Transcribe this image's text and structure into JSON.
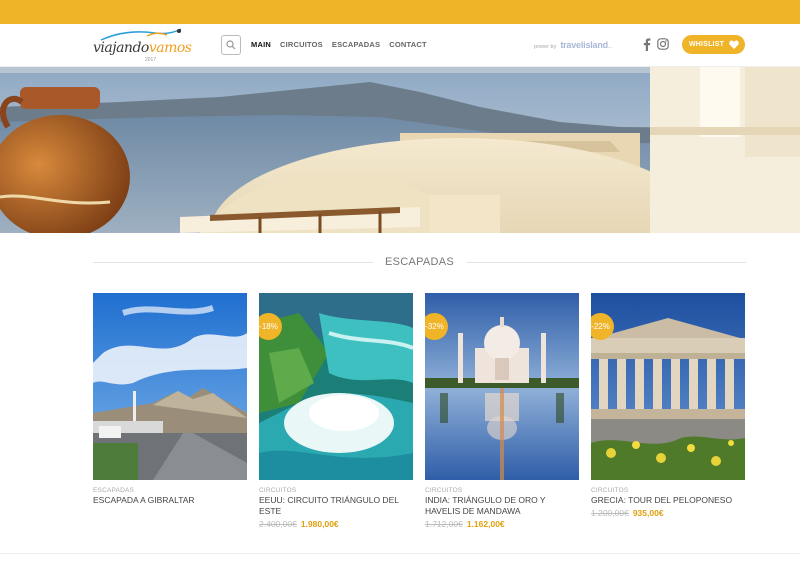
{
  "colors": {
    "accent": "#f0b429",
    "text": "#333333",
    "muted": "#aaaaaa"
  },
  "logo": {
    "text_main": "viajando",
    "text_accent": "vamos",
    "tagline": "2017"
  },
  "header": {
    "search_icon": "search-icon",
    "nav": [
      {
        "label": "MAIN",
        "active": true
      },
      {
        "label": "CIRCUITOS",
        "active": false
      },
      {
        "label": "ESCAPADAS",
        "active": false
      },
      {
        "label": "CONTACT",
        "active": false
      }
    ],
    "powered_by": "power by",
    "brand": "travelisland",
    "brand_suffix": "...",
    "social": [
      "facebook-icon",
      "instagram-icon"
    ],
    "wishlist_label": "WHISLIST",
    "wishlist_icon": "heart-icon"
  },
  "section": {
    "title": "ESCAPADAS"
  },
  "products": [
    {
      "category": "ESCAPADAS",
      "name": "ESCAPADA A GIBRALTAR",
      "badge": "",
      "old_price": "",
      "new_price": ""
    },
    {
      "category": "CIRCUITOS",
      "name": "EEUU: CIRCUITO TRIÁNGULO DEL ESTE",
      "badge": "-18%",
      "old_price": "2.400,00€",
      "new_price": "1.980,00€"
    },
    {
      "category": "CIRCUITOS",
      "name": "INDIA: TRIÁNGULO DE ORO Y HAVELIS DE MANDAWA",
      "badge": "-32%",
      "old_price": "1.712,00€",
      "new_price": "1.162,00€"
    },
    {
      "category": "CIRCUITOS",
      "name": "GRECIA: TOUR DEL PELOPONESO",
      "badge": "-22%",
      "old_price": "1.200,00€",
      "new_price": "935,00€"
    }
  ]
}
